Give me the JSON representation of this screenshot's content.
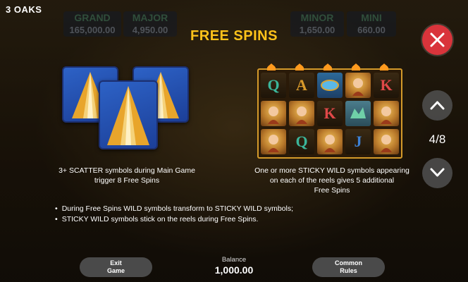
{
  "brand": "3 OAKS",
  "title": "FREE SPINS",
  "background_jackpots": [
    {
      "label": "GRAND",
      "value": "165,000.00"
    },
    {
      "label": "MAJOR",
      "value": "4,950.00"
    },
    {
      "label": "MINOR",
      "value": "1,650.00"
    },
    {
      "label": "MINI",
      "value": "660.00"
    }
  ],
  "pager": {
    "current_label": "4/8"
  },
  "left_panel": {
    "desc_line1": "3+ SCATTER symbols during Main Game",
    "desc_line2": "trigger 8 Free Spins",
    "symbol": "pyramid-scatter"
  },
  "right_panel": {
    "desc_line1": "One or more STICKY WILD symbols appearing",
    "desc_line2": "on each of the reels gives 5 additional",
    "desc_line3": "Free Spins",
    "grid": [
      [
        "Q",
        "A",
        "scarab",
        "queen",
        "K"
      ],
      [
        "queen",
        "queen",
        "K",
        "wild",
        "queen"
      ],
      [
        "queen",
        "Q",
        "queen",
        "J",
        "queen"
      ]
    ]
  },
  "rules": [
    "During Free Spins WILD symbols transform to STICKY WILD symbols;",
    "STICKY WILD symbols stick on the reels during Free Spins."
  ],
  "footer": {
    "exit_line1": "Exit",
    "exit_line2": "Game",
    "balance_label": "Balance",
    "balance_value": "1,000.00",
    "rules_line1": "Common",
    "rules_line2": "Rules"
  },
  "colors": {
    "title": "#ffc21a",
    "close_button": "#d9343b",
    "reel_border": "#d49a2a"
  }
}
